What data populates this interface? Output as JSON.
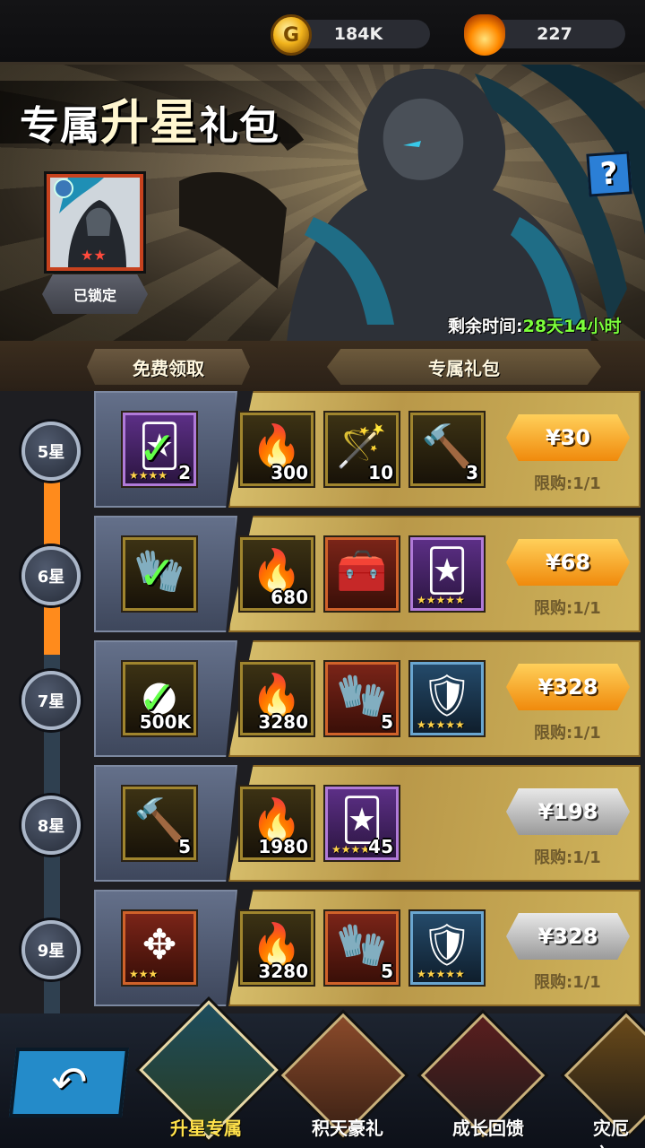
{
  "resources": {
    "gold": {
      "icon": "gold-coin-icon",
      "value": "184K"
    },
    "gem": {
      "icon": "flame-key-icon",
      "value": "227"
    }
  },
  "banner": {
    "title_part1": "专属",
    "title_part2": "升星",
    "title_part3": "礼包",
    "help_label": "?",
    "hero_stars": "★★",
    "lock_label": "已锁定",
    "timer_label": "剩余时间:",
    "timer_value": "28天14小时"
  },
  "columns": {
    "free": "免费领取",
    "pack": "专属礼包"
  },
  "rows": [
    {
      "star": "5星",
      "free": {
        "icon": "hero-card-icon",
        "count": "2",
        "stars": "★★★★",
        "claimed": true
      },
      "items": [
        {
          "icon": "flame-key-icon",
          "count": "300"
        },
        {
          "icon": "magic-wand-icon",
          "count": "10"
        },
        {
          "icon": "hammer-icon",
          "count": "3"
        }
      ],
      "price": "¥30",
      "price_style": "orange",
      "limit": "限购:1/1"
    },
    {
      "star": "6星",
      "free": {
        "icon": "glove-icon",
        "count": "",
        "stars": "",
        "claimed": true
      },
      "items": [
        {
          "icon": "flame-key-icon",
          "count": "680"
        },
        {
          "icon": "treasure-chest-icon",
          "count": ""
        },
        {
          "icon": "hero-card-icon",
          "count": "",
          "stars": "★★★★★"
        }
      ],
      "price": "¥68",
      "price_style": "orange",
      "limit": "限购:1/1"
    },
    {
      "star": "7星",
      "free": {
        "icon": "silver-orb-icon",
        "count": "500K",
        "stars": "",
        "claimed": true
      },
      "items": [
        {
          "icon": "flame-key-icon",
          "count": "3280"
        },
        {
          "icon": "gauntlet-icon",
          "count": "5"
        },
        {
          "icon": "hero-portrait-icon",
          "count": "",
          "stars": "★★★★★"
        }
      ],
      "price": "¥328",
      "price_style": "orange",
      "limit": "限购:1/1"
    },
    {
      "star": "8星",
      "free": {
        "icon": "hammer-icon",
        "count": "5",
        "stars": "",
        "claimed": false
      },
      "items": [
        {
          "icon": "flame-key-icon",
          "count": "1980"
        },
        {
          "icon": "hero-card-icon",
          "count": "45",
          "stars": "★★★★"
        }
      ],
      "price": "¥198",
      "price_style": "gray",
      "limit": "限购:1/1"
    },
    {
      "star": "9星",
      "free": {
        "icon": "earrings-icon",
        "count": "",
        "stars": "★★★",
        "claimed": false
      },
      "items": [
        {
          "icon": "flame-key-icon",
          "count": "3280"
        },
        {
          "icon": "gauntlet-icon",
          "count": "5"
        },
        {
          "icon": "hero-portrait-icon",
          "count": "",
          "stars": "★★★★★"
        }
      ],
      "price": "¥328",
      "price_style": "gray",
      "limit": "限购:1/1"
    }
  ],
  "bottom_nav": {
    "back": "↶",
    "tabs": [
      {
        "label": "升星专属",
        "active": true
      },
      {
        "label": "积天豪礼",
        "active": false
      },
      {
        "label": "成长回馈",
        "active": false
      },
      {
        "label": "灾厄之",
        "active": false
      }
    ]
  },
  "colors": {
    "accent_orange": "#f08a0c",
    "check_green": "#64ff4a",
    "timer_green": "#7cff3c",
    "nav_active": "#ffe14a"
  }
}
